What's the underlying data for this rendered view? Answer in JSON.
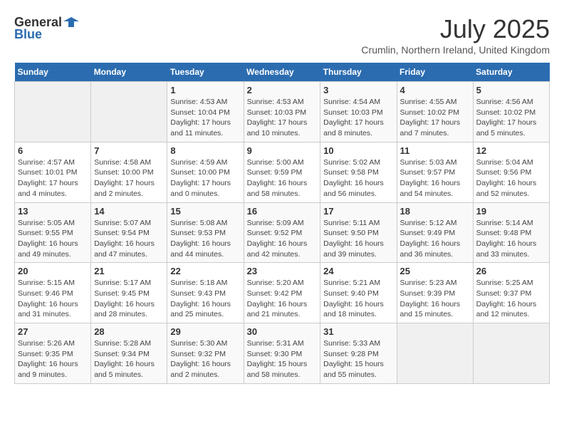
{
  "header": {
    "logo_general": "General",
    "logo_blue": "Blue",
    "month_year": "July 2025",
    "location": "Crumlin, Northern Ireland, United Kingdom"
  },
  "days_of_week": [
    "Sunday",
    "Monday",
    "Tuesday",
    "Wednesday",
    "Thursday",
    "Friday",
    "Saturday"
  ],
  "weeks": [
    [
      {
        "day": "",
        "info": ""
      },
      {
        "day": "",
        "info": ""
      },
      {
        "day": "1",
        "sunrise": "Sunrise: 4:53 AM",
        "sunset": "Sunset: 10:04 PM",
        "daylight": "Daylight: 17 hours and 11 minutes."
      },
      {
        "day": "2",
        "sunrise": "Sunrise: 4:53 AM",
        "sunset": "Sunset: 10:03 PM",
        "daylight": "Daylight: 17 hours and 10 minutes."
      },
      {
        "day": "3",
        "sunrise": "Sunrise: 4:54 AM",
        "sunset": "Sunset: 10:03 PM",
        "daylight": "Daylight: 17 hours and 8 minutes."
      },
      {
        "day": "4",
        "sunrise": "Sunrise: 4:55 AM",
        "sunset": "Sunset: 10:02 PM",
        "daylight": "Daylight: 17 hours and 7 minutes."
      },
      {
        "day": "5",
        "sunrise": "Sunrise: 4:56 AM",
        "sunset": "Sunset: 10:02 PM",
        "daylight": "Daylight: 17 hours and 5 minutes."
      }
    ],
    [
      {
        "day": "6",
        "sunrise": "Sunrise: 4:57 AM",
        "sunset": "Sunset: 10:01 PM",
        "daylight": "Daylight: 17 hours and 4 minutes."
      },
      {
        "day": "7",
        "sunrise": "Sunrise: 4:58 AM",
        "sunset": "Sunset: 10:00 PM",
        "daylight": "Daylight: 17 hours and 2 minutes."
      },
      {
        "day": "8",
        "sunrise": "Sunrise: 4:59 AM",
        "sunset": "Sunset: 10:00 PM",
        "daylight": "Daylight: 17 hours and 0 minutes."
      },
      {
        "day": "9",
        "sunrise": "Sunrise: 5:00 AM",
        "sunset": "Sunset: 9:59 PM",
        "daylight": "Daylight: 16 hours and 58 minutes."
      },
      {
        "day": "10",
        "sunrise": "Sunrise: 5:02 AM",
        "sunset": "Sunset: 9:58 PM",
        "daylight": "Daylight: 16 hours and 56 minutes."
      },
      {
        "day": "11",
        "sunrise": "Sunrise: 5:03 AM",
        "sunset": "Sunset: 9:57 PM",
        "daylight": "Daylight: 16 hours and 54 minutes."
      },
      {
        "day": "12",
        "sunrise": "Sunrise: 5:04 AM",
        "sunset": "Sunset: 9:56 PM",
        "daylight": "Daylight: 16 hours and 52 minutes."
      }
    ],
    [
      {
        "day": "13",
        "sunrise": "Sunrise: 5:05 AM",
        "sunset": "Sunset: 9:55 PM",
        "daylight": "Daylight: 16 hours and 49 minutes."
      },
      {
        "day": "14",
        "sunrise": "Sunrise: 5:07 AM",
        "sunset": "Sunset: 9:54 PM",
        "daylight": "Daylight: 16 hours and 47 minutes."
      },
      {
        "day": "15",
        "sunrise": "Sunrise: 5:08 AM",
        "sunset": "Sunset: 9:53 PM",
        "daylight": "Daylight: 16 hours and 44 minutes."
      },
      {
        "day": "16",
        "sunrise": "Sunrise: 5:09 AM",
        "sunset": "Sunset: 9:52 PM",
        "daylight": "Daylight: 16 hours and 42 minutes."
      },
      {
        "day": "17",
        "sunrise": "Sunrise: 5:11 AM",
        "sunset": "Sunset: 9:50 PM",
        "daylight": "Daylight: 16 hours and 39 minutes."
      },
      {
        "day": "18",
        "sunrise": "Sunrise: 5:12 AM",
        "sunset": "Sunset: 9:49 PM",
        "daylight": "Daylight: 16 hours and 36 minutes."
      },
      {
        "day": "19",
        "sunrise": "Sunrise: 5:14 AM",
        "sunset": "Sunset: 9:48 PM",
        "daylight": "Daylight: 16 hours and 33 minutes."
      }
    ],
    [
      {
        "day": "20",
        "sunrise": "Sunrise: 5:15 AM",
        "sunset": "Sunset: 9:46 PM",
        "daylight": "Daylight: 16 hours and 31 minutes."
      },
      {
        "day": "21",
        "sunrise": "Sunrise: 5:17 AM",
        "sunset": "Sunset: 9:45 PM",
        "daylight": "Daylight: 16 hours and 28 minutes."
      },
      {
        "day": "22",
        "sunrise": "Sunrise: 5:18 AM",
        "sunset": "Sunset: 9:43 PM",
        "daylight": "Daylight: 16 hours and 25 minutes."
      },
      {
        "day": "23",
        "sunrise": "Sunrise: 5:20 AM",
        "sunset": "Sunset: 9:42 PM",
        "daylight": "Daylight: 16 hours and 21 minutes."
      },
      {
        "day": "24",
        "sunrise": "Sunrise: 5:21 AM",
        "sunset": "Sunset: 9:40 PM",
        "daylight": "Daylight: 16 hours and 18 minutes."
      },
      {
        "day": "25",
        "sunrise": "Sunrise: 5:23 AM",
        "sunset": "Sunset: 9:39 PM",
        "daylight": "Daylight: 16 hours and 15 minutes."
      },
      {
        "day": "26",
        "sunrise": "Sunrise: 5:25 AM",
        "sunset": "Sunset: 9:37 PM",
        "daylight": "Daylight: 16 hours and 12 minutes."
      }
    ],
    [
      {
        "day": "27",
        "sunrise": "Sunrise: 5:26 AM",
        "sunset": "Sunset: 9:35 PM",
        "daylight": "Daylight: 16 hours and 9 minutes."
      },
      {
        "day": "28",
        "sunrise": "Sunrise: 5:28 AM",
        "sunset": "Sunset: 9:34 PM",
        "daylight": "Daylight: 16 hours and 5 minutes."
      },
      {
        "day": "29",
        "sunrise": "Sunrise: 5:30 AM",
        "sunset": "Sunset: 9:32 PM",
        "daylight": "Daylight: 16 hours and 2 minutes."
      },
      {
        "day": "30",
        "sunrise": "Sunrise: 5:31 AM",
        "sunset": "Sunset: 9:30 PM",
        "daylight": "Daylight: 15 hours and 58 minutes."
      },
      {
        "day": "31",
        "sunrise": "Sunrise: 5:33 AM",
        "sunset": "Sunset: 9:28 PM",
        "daylight": "Daylight: 15 hours and 55 minutes."
      },
      {
        "day": "",
        "info": ""
      },
      {
        "day": "",
        "info": ""
      }
    ]
  ]
}
